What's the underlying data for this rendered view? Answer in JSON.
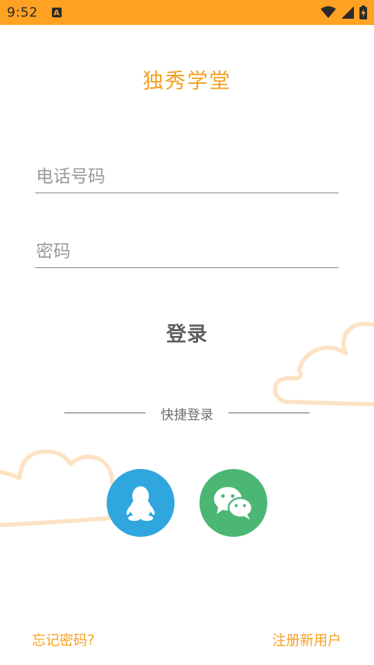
{
  "status_bar": {
    "time": "9:52",
    "notification_icon": "A",
    "icons": [
      "wifi-icon",
      "signal-icon",
      "battery-charging-icon"
    ],
    "background": "#ffa122"
  },
  "app": {
    "title": "独秀学堂",
    "accent_color": "#f5a021"
  },
  "form": {
    "phone_placeholder": "电话号码",
    "phone_value": "",
    "password_placeholder": "密码",
    "password_value": "",
    "login_label": "登录"
  },
  "quick_login": {
    "label": "快捷登录",
    "providers": [
      {
        "name": "QQ",
        "icon": "qq-penguin-icon",
        "color": "#30a6df"
      },
      {
        "name": "WeChat",
        "icon": "wechat-icon",
        "color": "#4cb775"
      }
    ]
  },
  "footer": {
    "forgot_password": "忘记密码?",
    "register": "注册新用户"
  }
}
